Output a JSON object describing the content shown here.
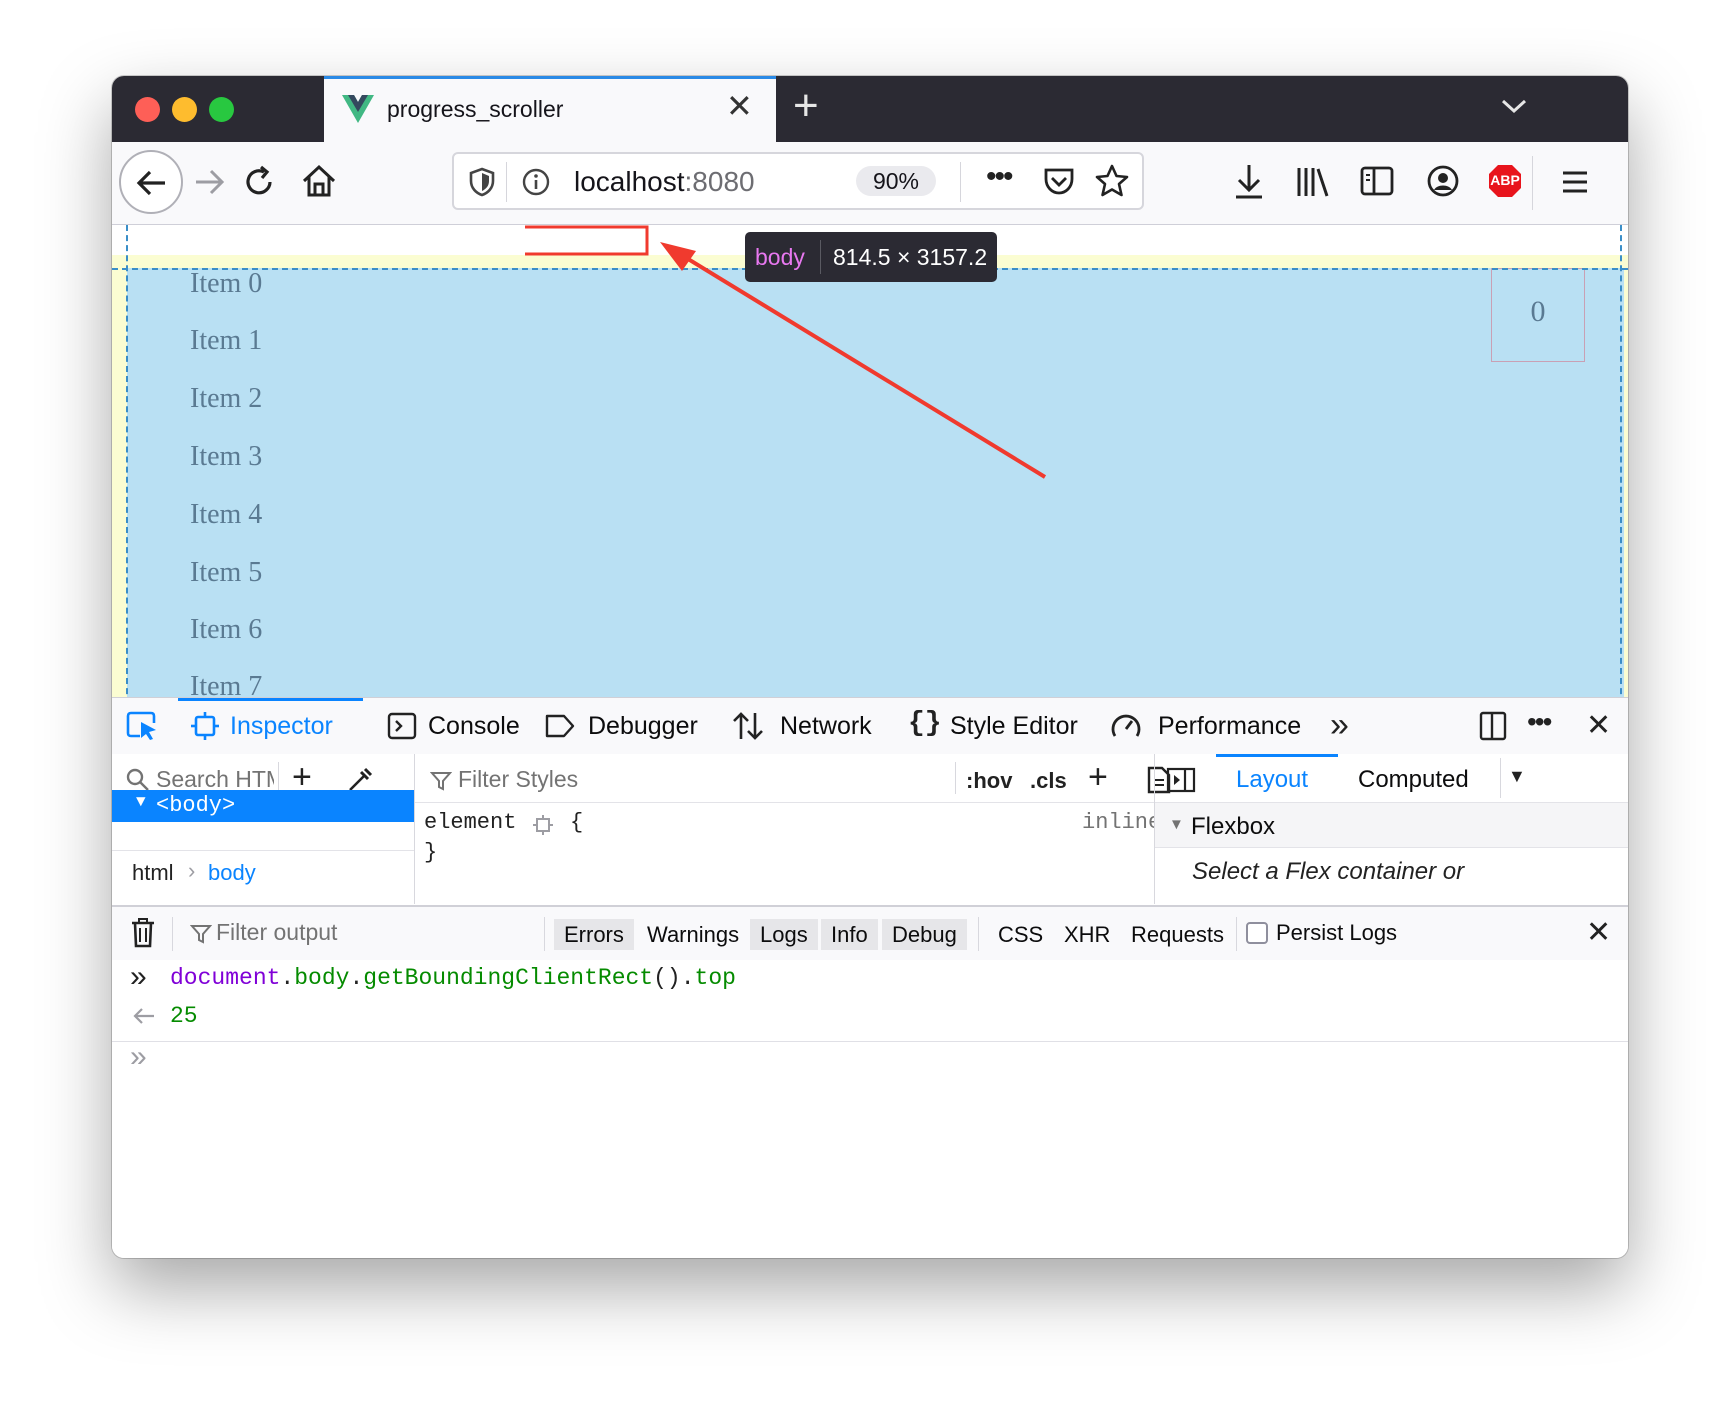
{
  "browser": {
    "tab_title": "progress_scroller",
    "url_host": "localhost",
    "url_port": ":8080",
    "zoom": "90%",
    "abp_label": "ABP"
  },
  "page": {
    "items": [
      "Item 0",
      "Item 1",
      "Item 2",
      "Item 3",
      "Item 4",
      "Item 5",
      "Item 6",
      "Item 7"
    ],
    "counter": "0",
    "tooltip_tag": "body",
    "tooltip_dims": "814.5 × 3157.2"
  },
  "devtools": {
    "tabs": [
      "Inspector",
      "Console",
      "Debugger",
      "Network",
      "Style Editor",
      "Performance"
    ],
    "search_placeholder": "Search HTML",
    "body_node": "<body>",
    "breadcrumb": [
      "html",
      "body"
    ],
    "filter_styles": "Filter Styles",
    "hov": ":hov",
    "cls": ".cls",
    "rule_selector": "element",
    "rule_open": "{",
    "rule_close": "}",
    "rule_source": "inline",
    "side_tabs": [
      "Layout",
      "Computed"
    ],
    "flexbox_label": "Flexbox",
    "flex_hint": "Select a Flex container or"
  },
  "console": {
    "filter_placeholder": "Filter output",
    "filters": [
      {
        "label": "Errors",
        "on": true
      },
      {
        "label": "Warnings",
        "on": false
      },
      {
        "label": "Logs",
        "on": true
      },
      {
        "label": "Info",
        "on": true
      },
      {
        "label": "Debug",
        "on": true
      }
    ],
    "type_filters": [
      "CSS",
      "XHR",
      "Requests"
    ],
    "persist_logs": "Persist Logs",
    "input_expr": {
      "obj": "document",
      "dot1": ".",
      "prop1": "body",
      "dot2": ".",
      "method": "getBoundingClientRect",
      "parens": "()",
      "dot3": ".",
      "prop2": "top"
    },
    "result": "25"
  },
  "colors": {
    "accent": "#0a84ff",
    "arrow": "#f03a2e",
    "page_blue": "#b9e0f3",
    "page_yellow": "#fbfdd2"
  }
}
